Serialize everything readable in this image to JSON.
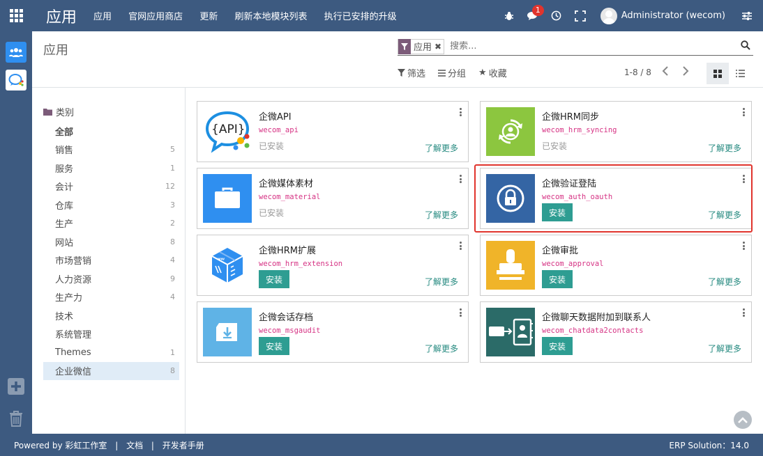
{
  "topbar": {
    "brand": "应用",
    "menu": [
      "应用",
      "官网应用商店",
      "更新",
      "刷新本地模块列表",
      "执行已安排的升级"
    ],
    "chat_badge": "1",
    "user_name": "Administrator (wecom)"
  },
  "control_panel": {
    "title": "应用",
    "facet_value": "应用",
    "search_placeholder": "搜索...",
    "filter_label": "筛选",
    "group_label": "分组",
    "favorite_label": "收藏",
    "pager": "1-8 / 8"
  },
  "categories": {
    "header": "类别",
    "items": [
      {
        "label": "全部",
        "count": ""
      },
      {
        "label": "销售",
        "count": "5"
      },
      {
        "label": "服务",
        "count": "1"
      },
      {
        "label": "会计",
        "count": "12"
      },
      {
        "label": "仓库",
        "count": "3"
      },
      {
        "label": "生产",
        "count": "2"
      },
      {
        "label": "网站",
        "count": "8"
      },
      {
        "label": "市场营销",
        "count": "4"
      },
      {
        "label": "人力资源",
        "count": "9"
      },
      {
        "label": "生产力",
        "count": "4"
      },
      {
        "label": "技术",
        "count": ""
      },
      {
        "label": "系统管理",
        "count": ""
      },
      {
        "label": "Themes",
        "count": "1"
      },
      {
        "label": "企业微信",
        "count": "8"
      }
    ]
  },
  "apps": [
    {
      "name": "企微API",
      "tech": "wecom_api",
      "status": "已安装",
      "action": "",
      "learn": "了解更多",
      "icon": "api-icon"
    },
    {
      "name": "企微HRM同步",
      "tech": "wecom_hrm_syncing",
      "status": "已安装",
      "action": "",
      "learn": "了解更多",
      "icon": "sync-user-icon"
    },
    {
      "name": "企微媒体素材",
      "tech": "wecom_material",
      "status": "已安装",
      "action": "",
      "learn": "了解更多",
      "icon": "briefcase-icon"
    },
    {
      "name": "企微验证登陆",
      "tech": "wecom_auth_oauth",
      "status": "",
      "action": "安装",
      "learn": "了解更多",
      "icon": "lock-icon"
    },
    {
      "name": "企微HRM扩展",
      "tech": "wecom_hrm_extension",
      "status": "",
      "action": "安装",
      "learn": "了解更多",
      "icon": "cube-icon"
    },
    {
      "name": "企微审批",
      "tech": "wecom_approval",
      "status": "",
      "action": "安装",
      "learn": "了解更多",
      "icon": "stamp-icon"
    },
    {
      "name": "企微会话存档",
      "tech": "wecom_msgaudit",
      "status": "",
      "action": "安装",
      "learn": "了解更多",
      "icon": "archive-download-icon"
    },
    {
      "name": "企微聊天数据附加到联系人",
      "tech": "wecom_chatdata2contacts",
      "status": "",
      "action": "安装",
      "learn": "了解更多",
      "icon": "contacts-icon"
    }
  ],
  "footer": {
    "powered": "Powered by 彩虹工作室",
    "docs": "文档",
    "dev_manual": "开发者手册",
    "version": "ERP Solution：14.0"
  }
}
